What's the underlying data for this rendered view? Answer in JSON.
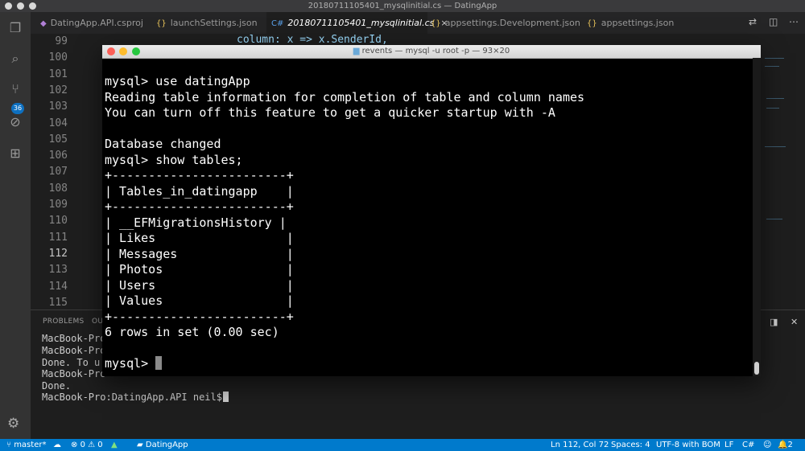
{
  "window": {
    "title": "20180711105401_mysqlinitial.cs — DatingApp"
  },
  "activity_bar": {
    "scm_badge": "36"
  },
  "tabs": [
    {
      "label": "DatingApp.API.csproj",
      "icon": "csproj-icon",
      "active": false
    },
    {
      "label": "launchSettings.json",
      "icon": "json-icon",
      "active": false
    },
    {
      "label": "20180711105401_mysqlinitial.cs",
      "icon": "csharp-icon",
      "active": true
    },
    {
      "label": "appsettings.Development.json",
      "icon": "json-icon",
      "active": false
    },
    {
      "label": "appsettings.json",
      "icon": "json-icon",
      "active": false
    }
  ],
  "tab_close_glyph": "×",
  "editor": {
    "line_numbers": [
      "99",
      "100",
      "101",
      "102",
      "103",
      "104",
      "105",
      "106",
      "107",
      "108",
      "109",
      "110",
      "111",
      "112",
      "113",
      "114",
      "115"
    ],
    "current_line": "112",
    "code_peek": "column: x => x.SenderId,"
  },
  "panel": {
    "tabs": [
      "PROBLEMS",
      "OU"
    ],
    "lines": [
      "MacBook-Pro",
      "MacBook-Pro",
      "Done. To u",
      "MacBook-Pro",
      "Done.",
      "MacBook-Pro:DatingApp.API neil$ "
    ]
  },
  "terminal": {
    "title": "revents — mysql -u root -p — 93×20",
    "lines": [
      "mysql> use datingApp",
      "Reading table information for completion of table and column names",
      "You can turn off this feature to get a quicker startup with -A",
      "",
      "Database changed",
      "mysql> show tables;",
      "+------------------------+",
      "| Tables_in_datingapp    |",
      "+------------------------+",
      "| __EFMigrationsHistory |",
      "| Likes                  |",
      "| Messages               |",
      "| Photos                 |",
      "| Users                  |",
      "| Values                 |",
      "+------------------------+",
      "6 rows in set (0.00 sec)",
      ""
    ],
    "prompt": "mysql> "
  },
  "status_bar": {
    "branch": "master*",
    "errors": "0",
    "warnings": "0",
    "project": "DatingApp",
    "position": "Ln 112, Col 72",
    "spaces": "Spaces: 4",
    "encoding": "UTF-8 with BOM",
    "eol": "LF",
    "language": "C#",
    "notifications": "2"
  },
  "colors": {
    "status_bar": "#007acc",
    "activity_bar": "#333333",
    "editor_bg": "#1e1e1e",
    "terminal_bg": "#000000"
  }
}
